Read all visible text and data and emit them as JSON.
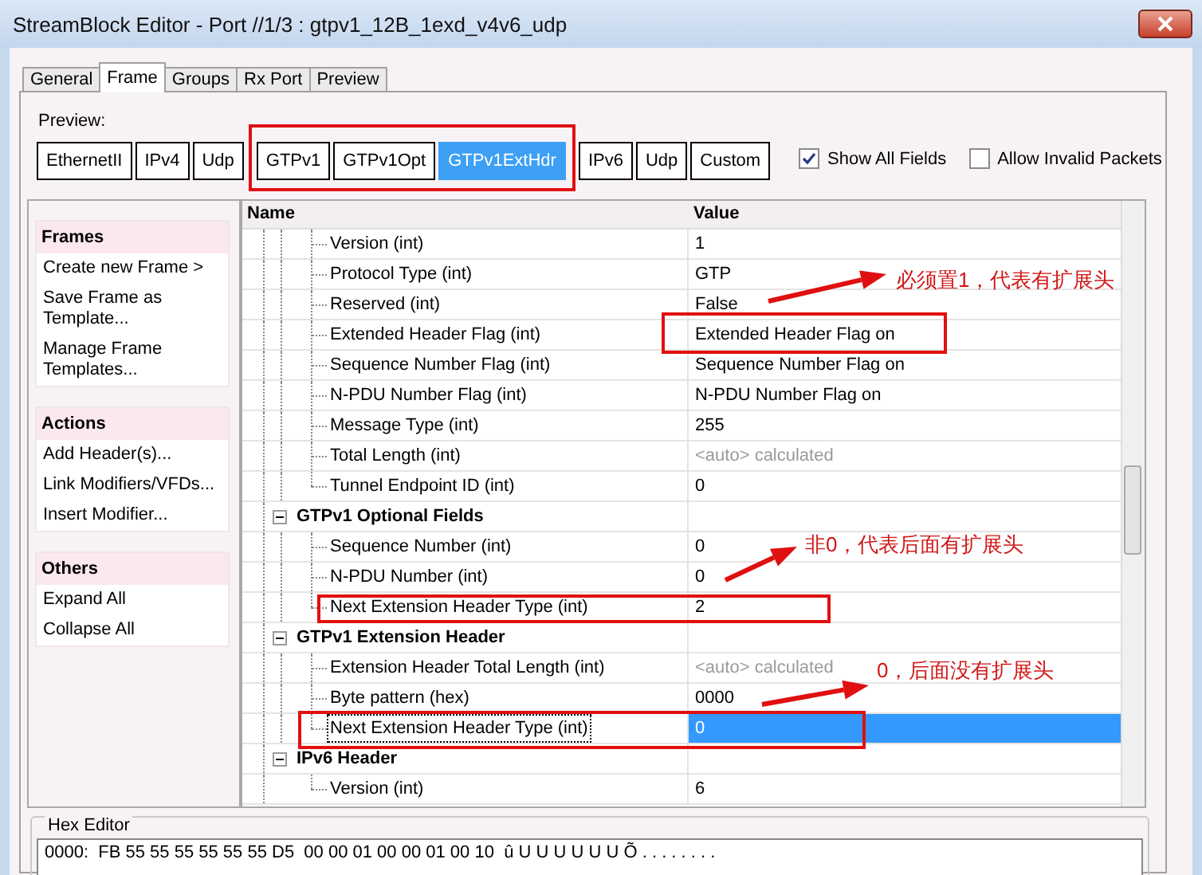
{
  "window": {
    "title": "StreamBlock Editor - Port //1/3 : gtpv1_12B_1exd_v4v6_udp"
  },
  "tabs": [
    {
      "label": "General",
      "selected": false
    },
    {
      "label": "Frame",
      "selected": true
    },
    {
      "label": "Groups",
      "selected": false
    },
    {
      "label": "Rx Port",
      "selected": false
    },
    {
      "label": "Preview",
      "selected": false
    }
  ],
  "preview": {
    "label": "Preview:",
    "headers": [
      {
        "label": "EthernetII",
        "selected": false
      },
      {
        "label": "IPv4",
        "selected": false
      },
      {
        "label": "Udp",
        "selected": false
      },
      {
        "label": "GTPv1",
        "selected": false
      },
      {
        "label": "GTPv1Opt",
        "selected": false
      },
      {
        "label": "GTPv1ExtHdr",
        "selected": true
      },
      {
        "label": "IPv6",
        "selected": false
      },
      {
        "label": "Udp",
        "selected": false
      },
      {
        "label": "Custom",
        "selected": false
      }
    ],
    "options": [
      {
        "label": "Show All Fields",
        "checked": true
      },
      {
        "label": "Allow Invalid Packets",
        "checked": false
      }
    ]
  },
  "sidebar": {
    "sections": [
      {
        "title": "Frames",
        "items": [
          "Create new Frame >",
          "Save Frame as Template...",
          "Manage Frame Templates..."
        ]
      },
      {
        "title": "Actions",
        "items": [
          "Add Header(s)...",
          "Link Modifiers/VFDs...",
          "Insert Modifier..."
        ]
      },
      {
        "title": "Others",
        "items": [
          "Expand All",
          "Collapse All"
        ]
      }
    ]
  },
  "tree": {
    "columns": [
      "Name",
      "Value"
    ],
    "items": [
      {
        "expanded": true,
        "children": [
          {
            "name": "Version (int)",
            "value": "1",
            "kind": "plain",
            "selected": false
          },
          {
            "name": "Protocol Type (int)",
            "value": "GTP",
            "kind": "plain",
            "selected": false
          },
          {
            "name": "Reserved (int)",
            "value": "False",
            "kind": "plain",
            "selected": false
          },
          {
            "name": "Extended Header Flag (int)",
            "value": "Extended Header Flag on",
            "kind": "plain",
            "selected": false
          },
          {
            "name": "Sequence Number Flag (int)",
            "value": "Sequence Number Flag on",
            "kind": "plain",
            "selected": false
          },
          {
            "name": "N-PDU Number Flag (int)",
            "value": "N-PDU Number Flag on",
            "kind": "plain",
            "selected": false
          },
          {
            "name": "Message Type (int)",
            "value": "255",
            "kind": "plain",
            "selected": false
          },
          {
            "name": "Total Length (int)",
            "value": "<auto> calculated",
            "kind": "auto",
            "selected": false
          },
          {
            "name": "Tunnel Endpoint ID (int)",
            "value": "0",
            "kind": "plain",
            "selected": false
          }
        ]
      },
      {
        "name": "GTPv1 Optional Fields",
        "expanded": true,
        "children": [
          {
            "name": "Sequence Number (int)",
            "value": "0",
            "kind": "plain",
            "selected": false
          },
          {
            "name": "N-PDU Number (int)",
            "value": "0",
            "kind": "plain",
            "selected": false
          },
          {
            "name": "Next Extension Header Type (int)",
            "value": "2",
            "kind": "plain",
            "selected": false
          }
        ]
      },
      {
        "name": "GTPv1 Extension Header",
        "expanded": true,
        "children": [
          {
            "name": "Extension Header Total Length (int)",
            "value": "<auto> calculated",
            "kind": "auto",
            "selected": false
          },
          {
            "name": "Byte pattern (hex)",
            "value": "0000",
            "kind": "plain",
            "selected": false
          },
          {
            "name": "Next Extension Header Type (int)",
            "value": "0",
            "kind": "plain",
            "selected": true
          }
        ]
      },
      {
        "name": "IPv6 Header",
        "expanded": true,
        "children": [
          {
            "name": "Version (int)",
            "value": "6",
            "kind": "plain",
            "selected": false
          }
        ]
      }
    ]
  },
  "annotations": {
    "notes": [
      "必须置1，代表有扩展头",
      "非0，代表后面有扩展头",
      "0，后面没有扩展头"
    ]
  },
  "hex_editor": {
    "title": "Hex Editor",
    "lines": [
      "0000:  FB 55 55 55 55 55 55 D5  00 00 01 00 00 01 00 10  û U U U U U U Õ . . . . . . . ."
    ]
  }
}
